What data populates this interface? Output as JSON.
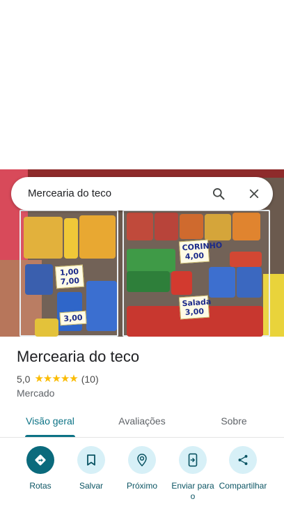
{
  "search": {
    "query": "Mercearia do teco",
    "search_icon": "search-icon",
    "close_icon": "close-icon"
  },
  "photo": {
    "price_tags": [
      "1,00 7,00",
      "CORINHO 4,00",
      "Salada 3,00",
      "3,00"
    ]
  },
  "place": {
    "name": "Mercearia do teco",
    "rating": "5,0",
    "stars_count": 5,
    "reviews": "(10)",
    "category": "Mercado"
  },
  "tabs": [
    {
      "label": "Visão geral",
      "active": true
    },
    {
      "label": "Avaliações",
      "active": false
    },
    {
      "label": "Sobre",
      "active": false
    }
  ],
  "actions": [
    {
      "label": "Rotas",
      "icon": "directions-icon"
    },
    {
      "label": "Salvar",
      "icon": "bookmark-icon"
    },
    {
      "label": "Próximo",
      "icon": "nearby-icon"
    },
    {
      "label": "Enviar para o",
      "icon": "send-to-phone-icon"
    },
    {
      "label": "Compartilhar",
      "icon": "share-icon"
    }
  ],
  "colors": {
    "accent": "#0b7285",
    "primary_action": "#0b6a7c",
    "action_bg": "#d7f0f7",
    "star": "#fbbc04"
  }
}
